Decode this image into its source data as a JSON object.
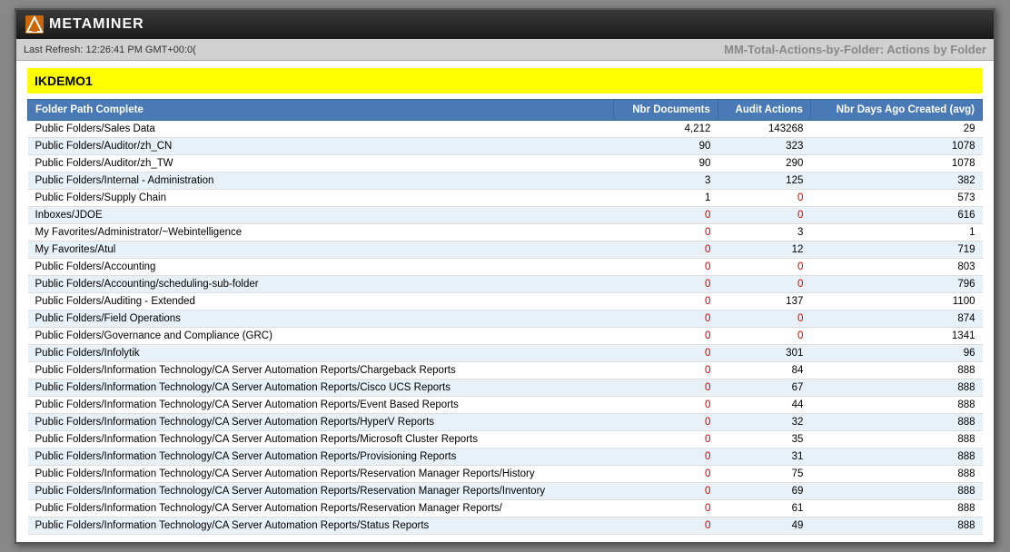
{
  "app": {
    "title": "METAMINER",
    "last_refresh": "Last Refresh: 12:26:41 PM GMT+00:0(",
    "report_title": "MM-Total-Actions-by-Folder: Actions by Folder"
  },
  "section": {
    "name": "IKDEMO1"
  },
  "table": {
    "headers": [
      {
        "key": "folder_path",
        "label": "Folder Path Complete",
        "align": "left"
      },
      {
        "key": "nbr_docs",
        "label": "Nbr Documents",
        "align": "right"
      },
      {
        "key": "audit_actions",
        "label": "Audit Actions",
        "align": "right"
      },
      {
        "key": "nbr_days_ago",
        "label": "Nbr Days Ago Created (avg)",
        "align": "right"
      }
    ],
    "rows": [
      {
        "folder_path": "Public Folders/Sales Data",
        "nbr_docs": "4,212",
        "audit_actions": "143268",
        "nbr_days_ago": "29",
        "docs_zero": false,
        "actions_zero": false
      },
      {
        "folder_path": "Public Folders/Auditor/zh_CN",
        "nbr_docs": "90",
        "audit_actions": "323",
        "nbr_days_ago": "1078",
        "docs_zero": false,
        "actions_zero": false
      },
      {
        "folder_path": "Public Folders/Auditor/zh_TW",
        "nbr_docs": "90",
        "audit_actions": "290",
        "nbr_days_ago": "1078",
        "docs_zero": false,
        "actions_zero": false
      },
      {
        "folder_path": "Public Folders/Internal - Administration",
        "nbr_docs": "3",
        "audit_actions": "125",
        "nbr_days_ago": "382",
        "docs_zero": false,
        "actions_zero": false
      },
      {
        "folder_path": "Public Folders/Supply Chain",
        "nbr_docs": "1",
        "audit_actions": "0",
        "nbr_days_ago": "573",
        "docs_zero": false,
        "actions_zero": true
      },
      {
        "folder_path": "Inboxes/JDOE",
        "nbr_docs": "0",
        "audit_actions": "0",
        "nbr_days_ago": "616",
        "docs_zero": true,
        "actions_zero": true
      },
      {
        "folder_path": "My Favorites/Administrator/~Webintelligence",
        "nbr_docs": "0",
        "audit_actions": "3",
        "nbr_days_ago": "1",
        "docs_zero": true,
        "actions_zero": false
      },
      {
        "folder_path": "My Favorites/Atul",
        "nbr_docs": "0",
        "audit_actions": "12",
        "nbr_days_ago": "719",
        "docs_zero": true,
        "actions_zero": false
      },
      {
        "folder_path": "Public Folders/Accounting",
        "nbr_docs": "0",
        "audit_actions": "0",
        "nbr_days_ago": "803",
        "docs_zero": true,
        "actions_zero": true
      },
      {
        "folder_path": "Public Folders/Accounting/scheduling-sub-folder",
        "nbr_docs": "0",
        "audit_actions": "0",
        "nbr_days_ago": "796",
        "docs_zero": true,
        "actions_zero": true
      },
      {
        "folder_path": "Public Folders/Auditing - Extended",
        "nbr_docs": "0",
        "audit_actions": "137",
        "nbr_days_ago": "1100",
        "docs_zero": true,
        "actions_zero": false
      },
      {
        "folder_path": "Public Folders/Field Operations",
        "nbr_docs": "0",
        "audit_actions": "0",
        "nbr_days_ago": "874",
        "docs_zero": true,
        "actions_zero": true
      },
      {
        "folder_path": "Public Folders/Governance and Compliance (GRC)",
        "nbr_docs": "0",
        "audit_actions": "0",
        "nbr_days_ago": "1341",
        "docs_zero": true,
        "actions_zero": true
      },
      {
        "folder_path": "Public Folders/Infolytik",
        "nbr_docs": "0",
        "audit_actions": "301",
        "nbr_days_ago": "96",
        "docs_zero": true,
        "actions_zero": false
      },
      {
        "folder_path": "Public Folders/Information Technology/CA Server Automation Reports/Chargeback Reports",
        "nbr_docs": "0",
        "audit_actions": "84",
        "nbr_days_ago": "888",
        "docs_zero": true,
        "actions_zero": false
      },
      {
        "folder_path": "Public Folders/Information Technology/CA Server Automation Reports/Cisco UCS Reports",
        "nbr_docs": "0",
        "audit_actions": "67",
        "nbr_days_ago": "888",
        "docs_zero": true,
        "actions_zero": false
      },
      {
        "folder_path": "Public Folders/Information Technology/CA Server Automation Reports/Event Based Reports",
        "nbr_docs": "0",
        "audit_actions": "44",
        "nbr_days_ago": "888",
        "docs_zero": true,
        "actions_zero": false
      },
      {
        "folder_path": "Public Folders/Information Technology/CA Server Automation Reports/HyperV Reports",
        "nbr_docs": "0",
        "audit_actions": "32",
        "nbr_days_ago": "888",
        "docs_zero": true,
        "actions_zero": false
      },
      {
        "folder_path": "Public Folders/Information Technology/CA Server Automation Reports/Microsoft Cluster Reports",
        "nbr_docs": "0",
        "audit_actions": "35",
        "nbr_days_ago": "888",
        "docs_zero": true,
        "actions_zero": false
      },
      {
        "folder_path": "Public Folders/Information Technology/CA Server Automation Reports/Provisioning Reports",
        "nbr_docs": "0",
        "audit_actions": "31",
        "nbr_days_ago": "888",
        "docs_zero": true,
        "actions_zero": false
      },
      {
        "folder_path": "Public Folders/Information Technology/CA Server Automation Reports/Reservation Manager Reports/History",
        "nbr_docs": "0",
        "audit_actions": "75",
        "nbr_days_ago": "888",
        "docs_zero": true,
        "actions_zero": false
      },
      {
        "folder_path": "Public Folders/Information Technology/CA Server Automation Reports/Reservation Manager Reports/Inventory",
        "nbr_docs": "0",
        "audit_actions": "69",
        "nbr_days_ago": "888",
        "docs_zero": true,
        "actions_zero": false
      },
      {
        "folder_path": "Public Folders/Information Technology/CA Server Automation Reports/Reservation Manager Reports/",
        "nbr_docs": "0",
        "audit_actions": "61",
        "nbr_days_ago": "888",
        "docs_zero": true,
        "actions_zero": false
      },
      {
        "folder_path": "Public Folders/Information Technology/CA Server Automation Reports/Status Reports",
        "nbr_docs": "0",
        "audit_actions": "49",
        "nbr_days_ago": "888",
        "docs_zero": true,
        "actions_zero": false
      }
    ]
  }
}
